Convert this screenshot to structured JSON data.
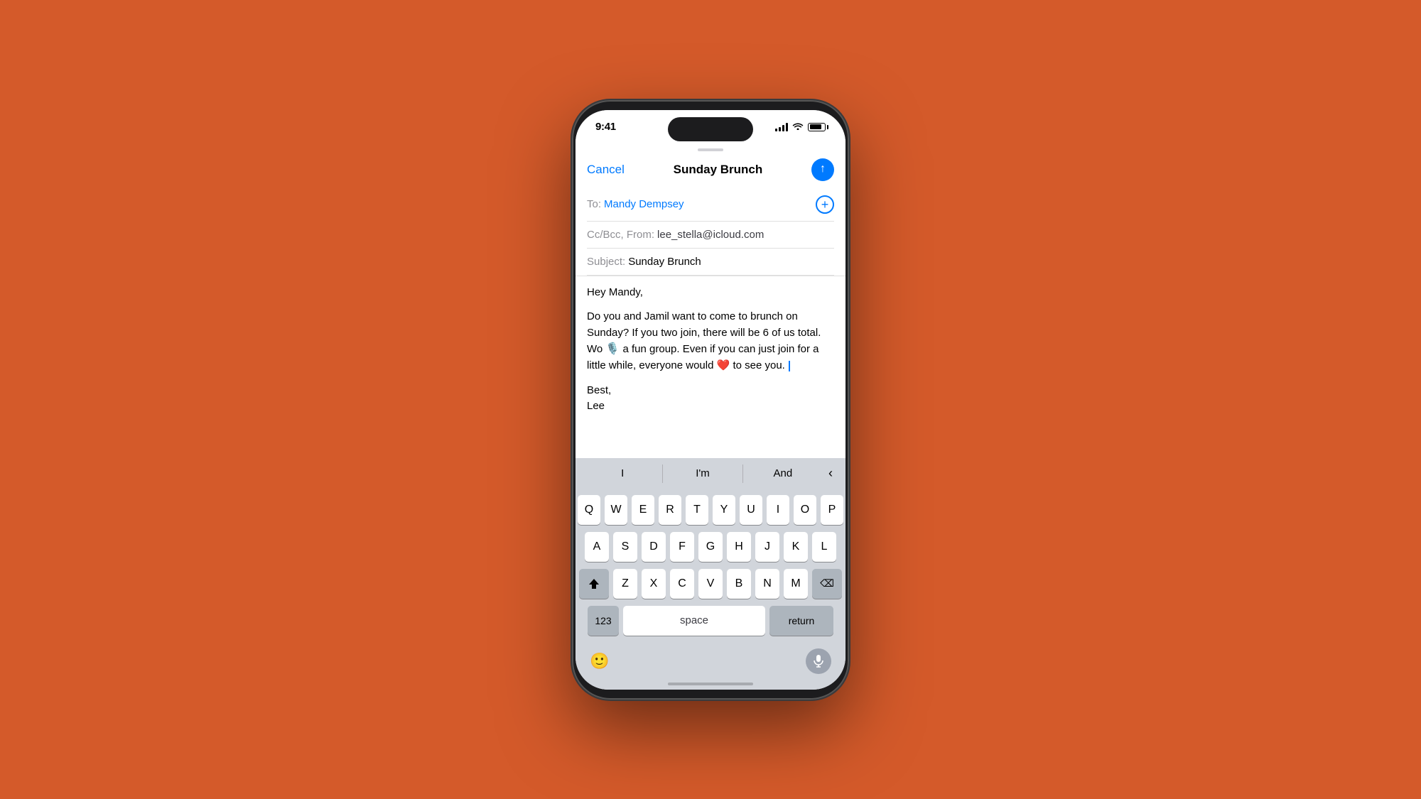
{
  "background": "#d45a2a",
  "status_bar": {
    "time": "9:41",
    "signal_bars": [
      4,
      6,
      8,
      10,
      12
    ],
    "battery_level": 80
  },
  "compose": {
    "cancel_label": "Cancel",
    "title": "Sunday Brunch",
    "to_label": "To:",
    "to_value": "Mandy Dempsey",
    "add_icon": "+",
    "cc_label": "Cc/Bcc, From:",
    "cc_value": "lee_stella@icloud.com",
    "subject_label": "Subject:",
    "subject_value": "Sunday Brunch",
    "body_greeting": "Hey Mandy,",
    "body_paragraph": "Do you and Jamil want to come to brunch on Sunday? If you two join, there will be 6 of us total. Wo  a fun group. Even if you can just join for a little while, everyone would ❤️ to see you. ",
    "signature_line1": "Best,",
    "signature_line2": "Lee"
  },
  "predictive": {
    "item1": "I",
    "item2": "I'm",
    "item3": "And"
  },
  "keyboard": {
    "row1": [
      "Q",
      "W",
      "E",
      "R",
      "T",
      "Y",
      "U",
      "I",
      "O",
      "P"
    ],
    "row2": [
      "A",
      "S",
      "D",
      "F",
      "G",
      "H",
      "J",
      "K",
      "L"
    ],
    "row3": [
      "Z",
      "X",
      "C",
      "V",
      "B",
      "N",
      "M"
    ],
    "shift_label": "⇧",
    "delete_label": "⌫",
    "numbers_label": "123",
    "space_label": "space",
    "return_label": "return"
  }
}
